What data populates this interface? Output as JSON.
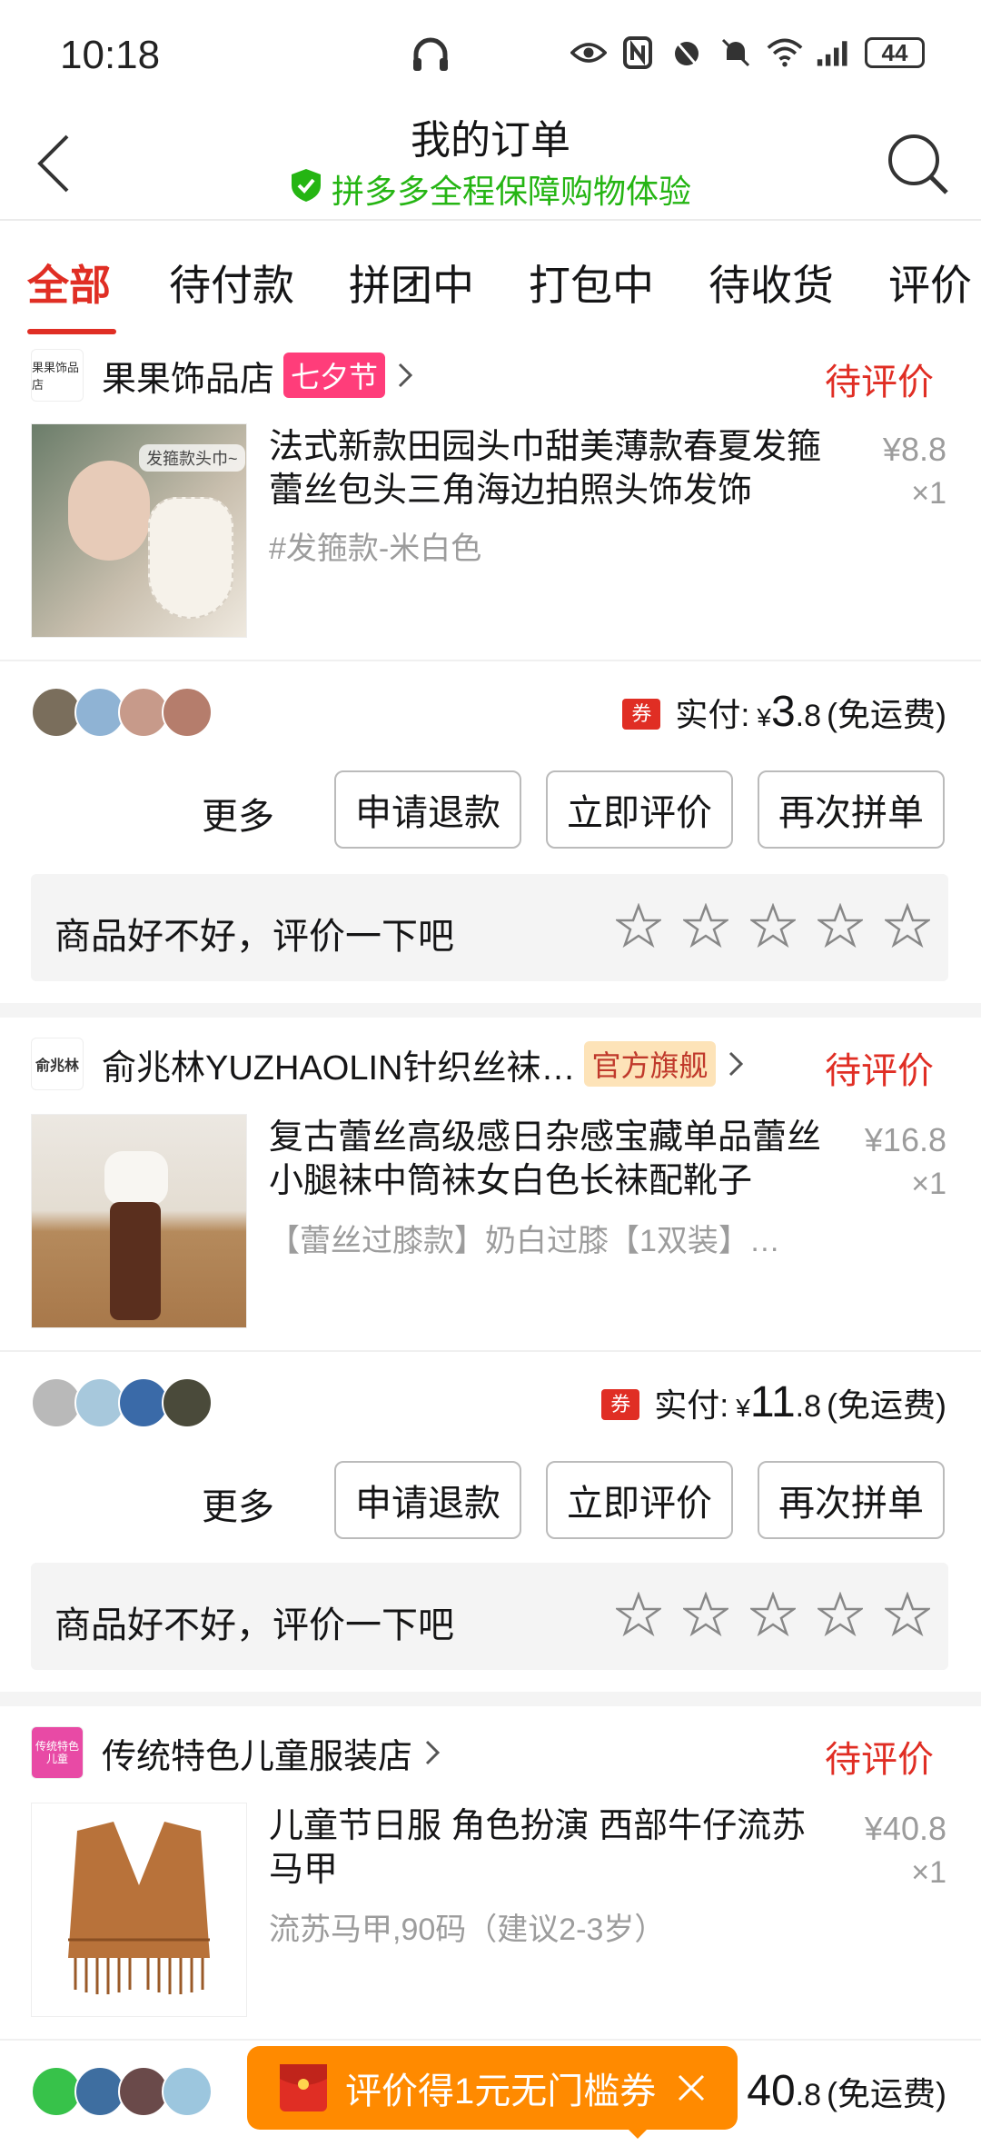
{
  "status_bar": {
    "time": "10:18",
    "battery": "44"
  },
  "nav": {
    "title": "我的订单",
    "subtitle": "拼多多全程保障购物体验"
  },
  "tabs": [
    "全部",
    "待付款",
    "拼团中",
    "打包中",
    "待收货",
    "评价"
  ],
  "orders": [
    {
      "shop_name": "果果饰品店",
      "shop_logo": "果果饰品店",
      "badge": "七夕节",
      "status": "待评价",
      "product_title": "法式新款田园头巾甜美薄款春夏发箍蕾丝包头三角海边拍照头饰发饰",
      "product_img_text": "发箍款头巾~",
      "sku": "#发箍款-米白色",
      "price": "¥8.8",
      "qty": "×1",
      "paid_label": "实付:",
      "paid_yen": "¥",
      "paid_int": "3",
      "paid_dec": ".8",
      "shipping": "(免运费)",
      "coupon": "券",
      "more": "更多",
      "btn_refund": "申请退款",
      "btn_review": "立即评价",
      "btn_rebuy": "再次拼单",
      "review_prompt": "商品好不好，评价一下吧"
    },
    {
      "shop_name": "俞兆林YUZHAOLIN针织丝袜…",
      "shop_logo": "俞兆林",
      "badge": "官方旗舰",
      "status": "待评价",
      "product_title": "复古蕾丝高级感日杂感宝藏单品蕾丝小腿袜中筒袜女白色长袜配靴子",
      "sku": "【蕾丝过膝款】奶白过膝【1双装】…",
      "price": "¥16.8",
      "qty": "×1",
      "paid_label": "实付:",
      "paid_yen": "¥",
      "paid_int": "11",
      "paid_dec": ".8",
      "shipping": "(免运费)",
      "coupon": "券",
      "more": "更多",
      "btn_refund": "申请退款",
      "btn_review": "立即评价",
      "btn_rebuy": "再次拼单",
      "review_prompt": "商品好不好，评价一下吧"
    },
    {
      "shop_name": "传统特色儿童服装店",
      "shop_logo": "传统特色儿童",
      "status": "待评价",
      "product_title": "儿童节日服 角色扮演 西部牛仔流苏马甲",
      "sku": "流苏马甲,90码（建议2-3岁）",
      "price": "¥40.8",
      "qty": "×1",
      "paid_partial": "40",
      "paid_dec": ".8",
      "shipping": "(免运费)"
    }
  ],
  "toast": {
    "text": "评价得1元无门槛券"
  },
  "colors": {
    "accent": "#e02e24",
    "green": "#25b513",
    "toast": "#ff8a00"
  }
}
